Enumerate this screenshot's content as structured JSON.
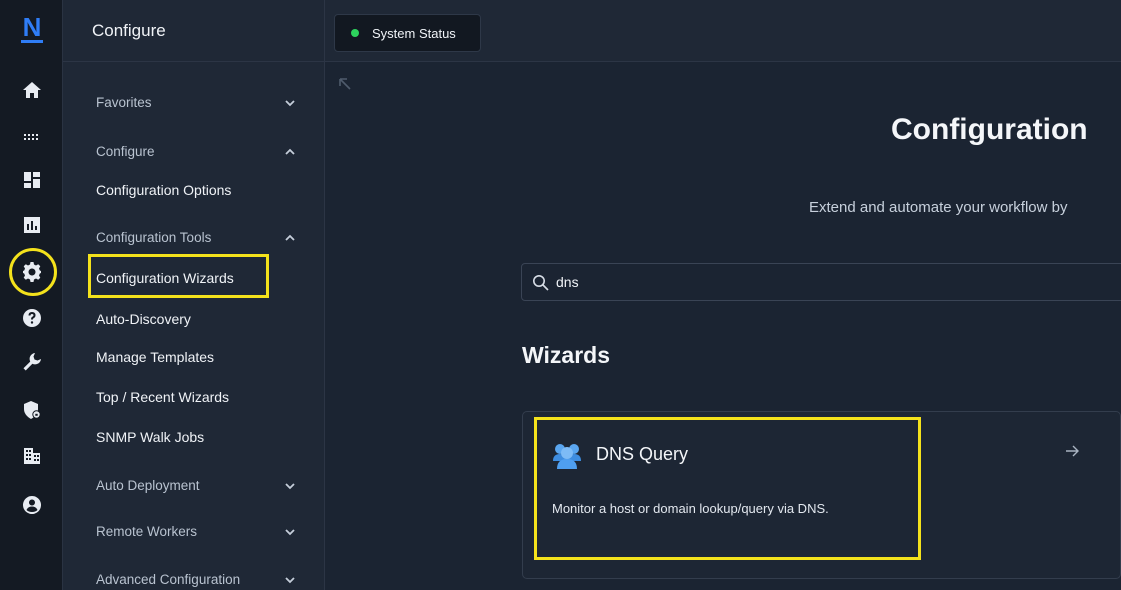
{
  "rail": {
    "logo": "N",
    "icons": [
      "home-icon",
      "apps-grid-icon",
      "dashboard-icon",
      "reports-icon",
      "gear-icon",
      "help-icon",
      "wrench-icon",
      "shield-lock-icon",
      "building-icon",
      "user-icon"
    ]
  },
  "sidebar": {
    "header": "Configure",
    "groups": {
      "favorites": "Favorites",
      "configure": "Configure",
      "configuration_tools": "Configuration Tools",
      "auto_deployment": "Auto Deployment",
      "remote_workers": "Remote Workers",
      "advanced_configuration": "Advanced Configuration"
    },
    "items": {
      "configuration_options": "Configuration Options",
      "configuration_wizards": "Configuration Wizards",
      "auto_discovery": "Auto-Discovery",
      "manage_templates": "Manage Templates",
      "top_recent_wizards": "Top / Recent Wizards",
      "snmp_walk_jobs": "SNMP Walk Jobs"
    }
  },
  "topbar": {
    "tab_label": "System Status",
    "status_color": "#2dd35d"
  },
  "main": {
    "title": "Configuration",
    "subtitle": "Extend and automate your workflow by",
    "search": {
      "value": "dns"
    },
    "section_title": "Wizards",
    "card": {
      "title": "DNS Query",
      "description": "Monitor a host or domain lookup/query via DNS."
    }
  },
  "colors": {
    "highlight": "#f4e21c",
    "accent": "#2f7df6"
  }
}
